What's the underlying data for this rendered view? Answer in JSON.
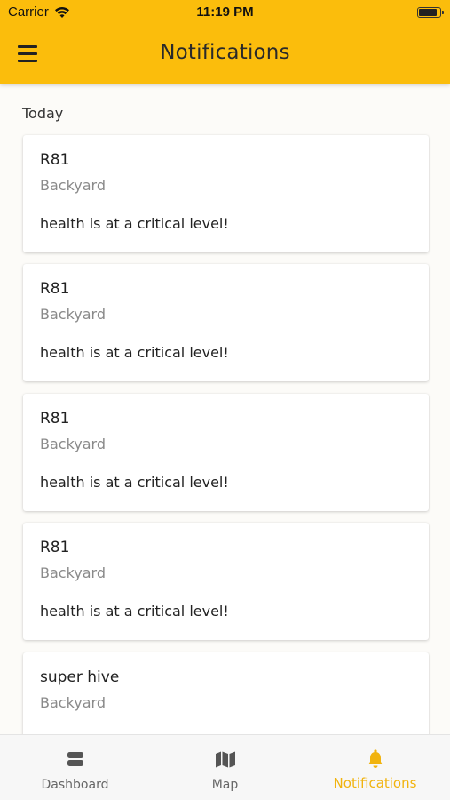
{
  "status_bar": {
    "carrier": "Carrier",
    "time": "11:19 PM"
  },
  "header": {
    "title": "Notifications",
    "background_color": "#fbbd0c"
  },
  "section": {
    "label": "Today"
  },
  "notifications": [
    {
      "title": "R81",
      "location": "Backyard",
      "message": "health is at a critical level!"
    },
    {
      "title": "R81",
      "location": "Backyard",
      "message": "health is at a critical level!"
    },
    {
      "title": "R81",
      "location": "Backyard",
      "message": "health is at a critical level!"
    },
    {
      "title": "R81",
      "location": "Backyard",
      "message": "health is at a critical level!"
    },
    {
      "title": "super hive",
      "location": "Backyard",
      "message": ""
    }
  ],
  "tab_bar": {
    "active_color": "#f1b30e",
    "tabs": [
      {
        "label": "Dashboard",
        "icon": "dashboard-icon"
      },
      {
        "label": "Map",
        "icon": "map-icon"
      },
      {
        "label": "Notifications",
        "icon": "bell-icon",
        "active": true
      }
    ]
  }
}
